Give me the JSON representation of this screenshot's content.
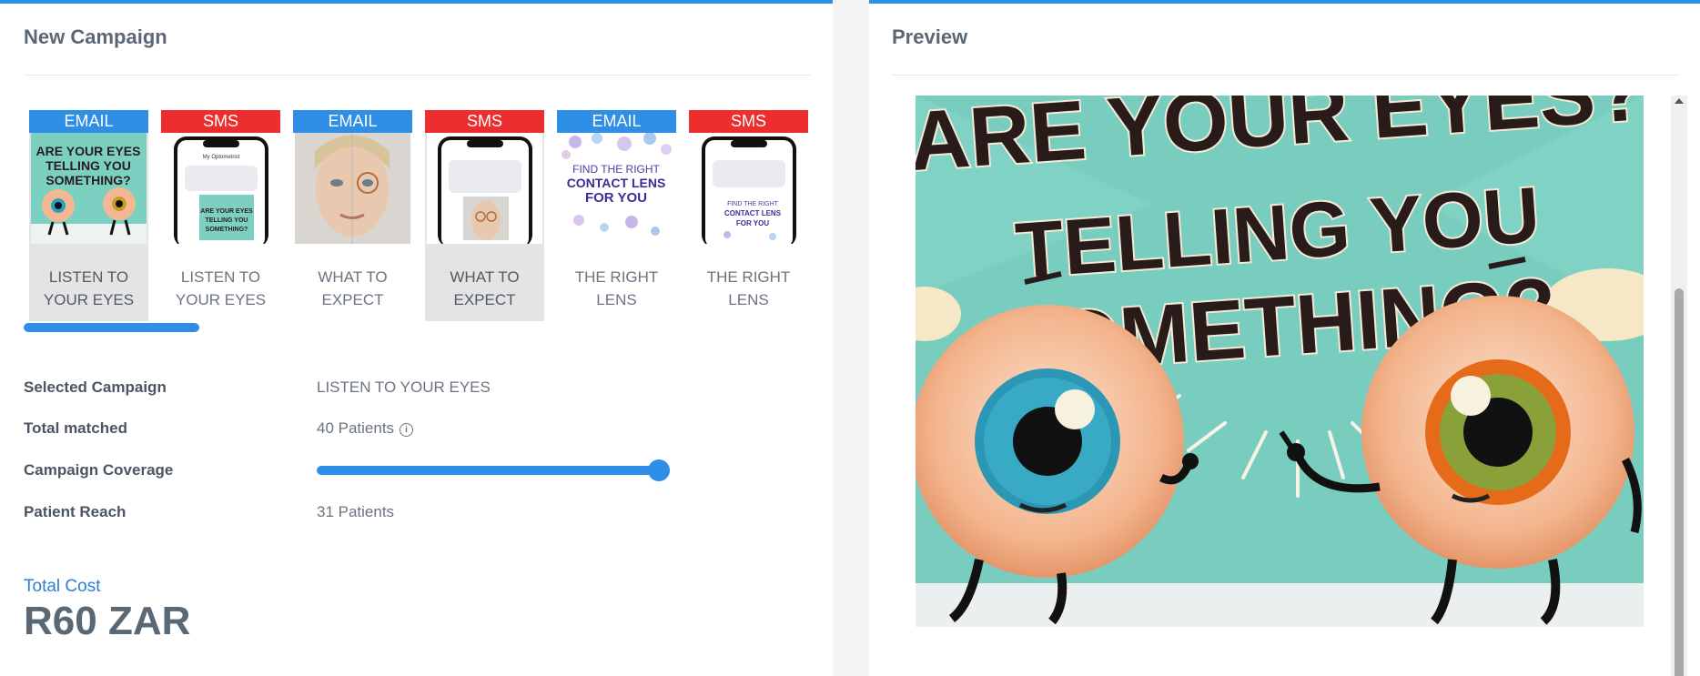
{
  "new_campaign": {
    "title": "New Campaign",
    "cards": [
      {
        "type": "EMAIL",
        "label_line1": "LISTEN TO",
        "label_line2": "YOUR EYES",
        "thumb_icon": "eyes-poster-thumbnail",
        "selected": true
      },
      {
        "type": "SMS",
        "label_line1": "LISTEN TO",
        "label_line2": "YOUR EYES",
        "thumb_icon": "phone-sms-thumbnail",
        "selected": false
      },
      {
        "type": "EMAIL",
        "label_line1": "WHAT TO",
        "label_line2": "EXPECT",
        "thumb_icon": "woman-face-thumbnail",
        "selected": false
      },
      {
        "type": "SMS",
        "label_line1": "WHAT TO",
        "label_line2": "EXPECT",
        "thumb_icon": "phone-sms-thumbnail",
        "selected": true
      },
      {
        "type": "EMAIL",
        "label_line1": "THE RIGHT",
        "label_line2": "LENS",
        "thumb_icon": "contact-lens-thumbnail",
        "thumb_text": [
          "FIND THE RIGHT",
          "CONTACT LENS",
          "FOR YOU"
        ],
        "selected": false
      },
      {
        "type": "SMS",
        "label_line1": "THE RIGHT",
        "label_line2": "LENS",
        "thumb_icon": "phone-sms-thumbnail",
        "selected": false
      }
    ],
    "thumb_poster_text": [
      "ARE YOUR EYES",
      "TELLING YOU",
      "SOMETHING?"
    ],
    "phone_header": "My Optometrist",
    "carousel_progress": 0.33,
    "selected_campaign_label": "Selected Campaign",
    "selected_campaign_value": "LISTEN TO YOUR EYES",
    "total_matched_label": "Total matched",
    "total_matched_value": "40 Patients",
    "coverage_label": "Campaign Coverage",
    "coverage_value": 1.0,
    "patient_reach_label": "Patient Reach",
    "patient_reach_value": "31 Patients",
    "total_cost_label": "Total Cost",
    "total_cost_value": "R60 ZAR"
  },
  "preview": {
    "title": "Preview",
    "poster_line1": "ARE YOUR EYES?",
    "poster_line2": "TELLING YOU",
    "poster_line3": "SOMETHING?"
  },
  "colors": {
    "accent": "#2f8fe6",
    "email_badge": "#2f8fe6",
    "sms_badge": "#ee2e2e",
    "poster_bg": "#79cdbf"
  }
}
